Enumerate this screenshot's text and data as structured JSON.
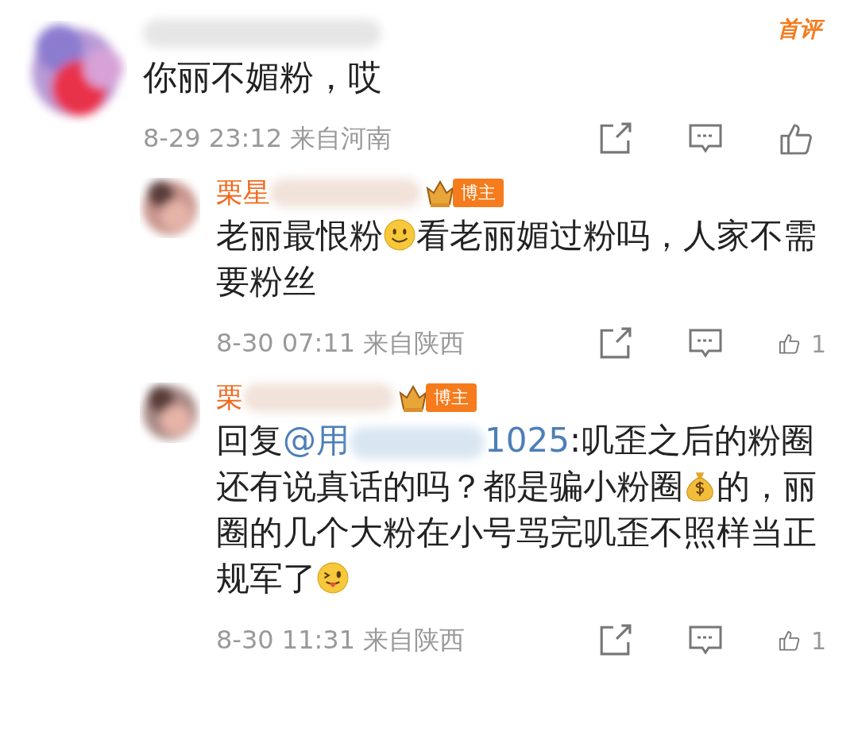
{
  "comment": {
    "first_badge": "首评",
    "segments": [
      {
        "kind": "text",
        "text": "你丽不媚粉，哎"
      }
    ],
    "time": "8-29 23:12",
    "location": "来自河南",
    "replies": [
      {
        "name": "栗星",
        "badge": "博主",
        "segments": [
          {
            "kind": "text",
            "text": "老丽最恨粉"
          },
          {
            "kind": "smile"
          },
          {
            "kind": "text",
            "text": "看老丽媚过粉吗，人家不需要粉丝"
          }
        ],
        "time": "8-30 07:11",
        "location": "来自陕西",
        "likes": "1"
      },
      {
        "name": "栗",
        "badge": "博主",
        "segments": [
          {
            "kind": "text",
            "text": "回复"
          },
          {
            "kind": "mention",
            "text": "@用"
          },
          {
            "kind": "blur"
          },
          {
            "kind": "mention",
            "text": "1025"
          },
          {
            "kind": "text",
            "text": ":叽歪之后的粉圈还有说真话的吗？都是骗小粉圈"
          },
          {
            "kind": "money"
          },
          {
            "kind": "text",
            "text": "的，丽圈的几个大粉在小号骂完叽歪不照样当正规军了"
          },
          {
            "kind": "wink"
          }
        ],
        "time": "8-30 11:31",
        "location": "来自陕西",
        "likes": "1"
      }
    ]
  }
}
